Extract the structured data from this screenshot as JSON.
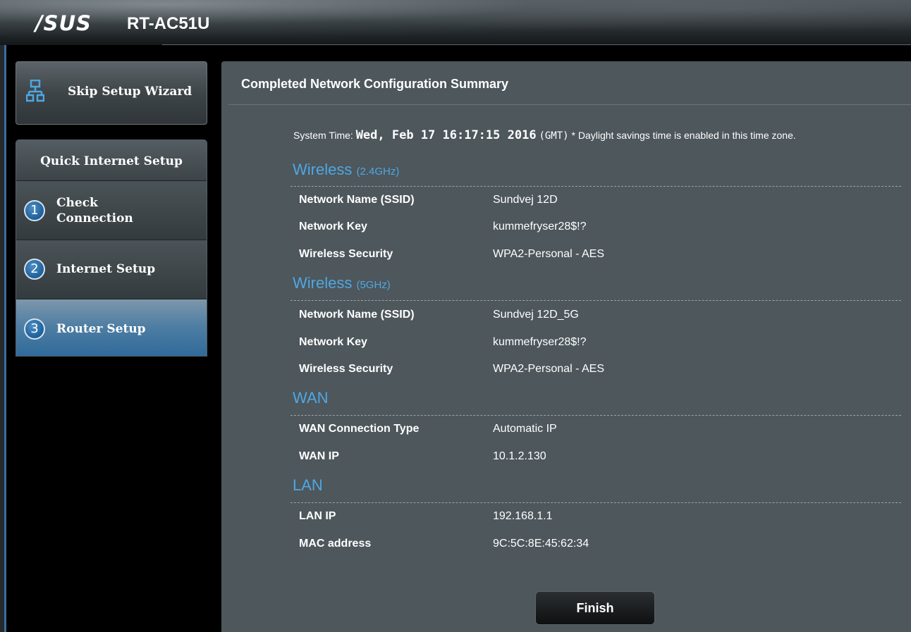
{
  "header": {
    "brand": "/SUS",
    "model": "RT-AC51U"
  },
  "sidebar": {
    "skip_wizard_label": "Skip Setup Wizard",
    "steps_heading": "Quick Internet Setup",
    "steps": [
      {
        "number": "1",
        "label_line1": "Check",
        "label_line2": "Connection"
      },
      {
        "number": "2",
        "label": "Internet Setup"
      },
      {
        "number": "3",
        "label": "Router Setup"
      }
    ]
  },
  "main": {
    "title": "Completed Network Configuration Summary",
    "system_time_label": "System Time:",
    "system_time_value": "Wed, Feb 17 16:17:15 2016",
    "system_time_zone": "(GMT)",
    "dst_note": "* Daylight savings time is enabled in this time zone.",
    "wireless24": {
      "title": "Wireless",
      "band": "(2.4GHz)",
      "rows": [
        {
          "label": "Network Name (SSID)",
          "value": "Sundvej 12D"
        },
        {
          "label": "Network Key",
          "value": "kummefryser28$!?"
        },
        {
          "label": "Wireless Security",
          "value": "WPA2-Personal - AES"
        }
      ]
    },
    "wireless5": {
      "title": "Wireless",
      "band": "(5GHz)",
      "rows": [
        {
          "label": "Network Name (SSID)",
          "value": "Sundvej 12D_5G"
        },
        {
          "label": "Network Key",
          "value": "kummefryser28$!?"
        },
        {
          "label": "Wireless Security",
          "value": "WPA2-Personal - AES"
        }
      ]
    },
    "wan": {
      "title": "WAN",
      "rows": [
        {
          "label": "WAN Connection Type",
          "value": "Automatic IP"
        },
        {
          "label": "WAN IP",
          "value": "10.1.2.130"
        }
      ]
    },
    "lan": {
      "title": "LAN",
      "rows": [
        {
          "label": "LAN IP",
          "value": "192.168.1.1"
        },
        {
          "label": "MAC address",
          "value": "9C:5C:8E:45:62:34"
        }
      ]
    },
    "finish_label": "Finish"
  },
  "colors": {
    "accent": "#4fa7e3",
    "panel": "#4d575c",
    "active_step": "#2d6899"
  }
}
